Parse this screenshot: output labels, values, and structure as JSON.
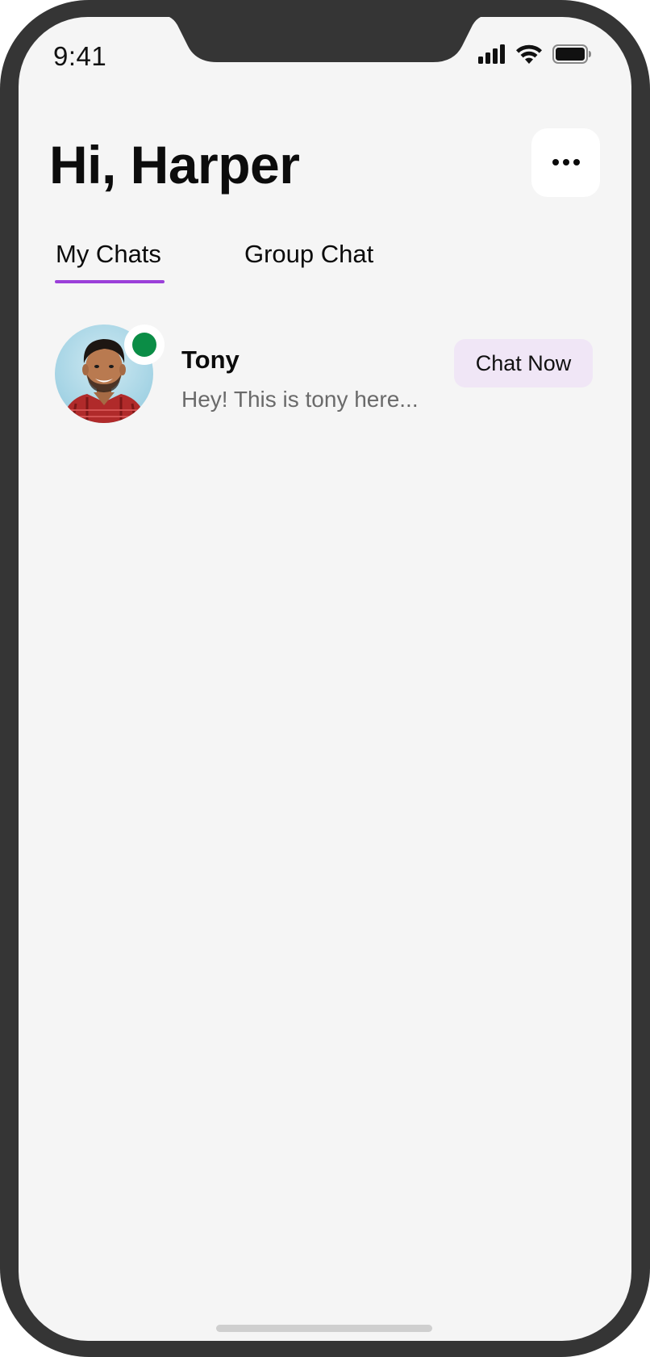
{
  "status_bar": {
    "time": "9:41"
  },
  "header": {
    "greeting": "Hi, Harper"
  },
  "tabs": [
    {
      "label": "My Chats",
      "active": true
    },
    {
      "label": "Group Chat",
      "active": false
    }
  ],
  "chats": [
    {
      "name": "Tony",
      "preview": "Hey! This is tony here...",
      "online": true,
      "action_label": "Chat Now"
    }
  ],
  "colors": {
    "accent": "#9b40d9",
    "online": "#0b8d46",
    "chat_now_bg": "#f0e6f6",
    "background": "#f5f5f5",
    "frame": "#353535"
  },
  "icons": {
    "more": "more-horizontal-icon",
    "signal": "cellular-signal-icon",
    "wifi": "wifi-icon",
    "battery": "battery-icon"
  }
}
